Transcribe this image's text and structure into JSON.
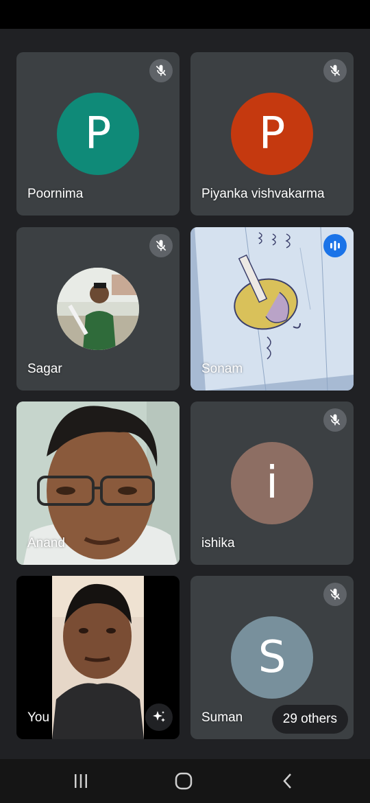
{
  "participants": [
    {
      "name": "Poornima",
      "initial": "P",
      "color": "#0f8a78",
      "muted": true
    },
    {
      "name": "Piyanka vishvakarma",
      "initial": "P",
      "color": "#c5390f",
      "muted": true
    },
    {
      "name": "Sagar",
      "muted": true,
      "avatar": "photo"
    },
    {
      "name": "Sonam",
      "muted": false,
      "speaking": true,
      "video": "paper-drawing"
    },
    {
      "name": "Anand",
      "video": "camera"
    },
    {
      "name": "ishika",
      "initial": "i",
      "color": "#8d6e63",
      "muted": true
    },
    {
      "name": "You",
      "video": "camera-self"
    },
    {
      "name": "Suman",
      "initial": "S",
      "color": "#78909c",
      "muted": true
    }
  ],
  "others_label": "29 others",
  "icons": {
    "mute": "mic-off-icon",
    "speaking": "audio-level-icon",
    "effects": "sparkle-effects-icon",
    "nav_recents": "recents-icon",
    "nav_home": "home-icon",
    "nav_back": "back-icon"
  }
}
